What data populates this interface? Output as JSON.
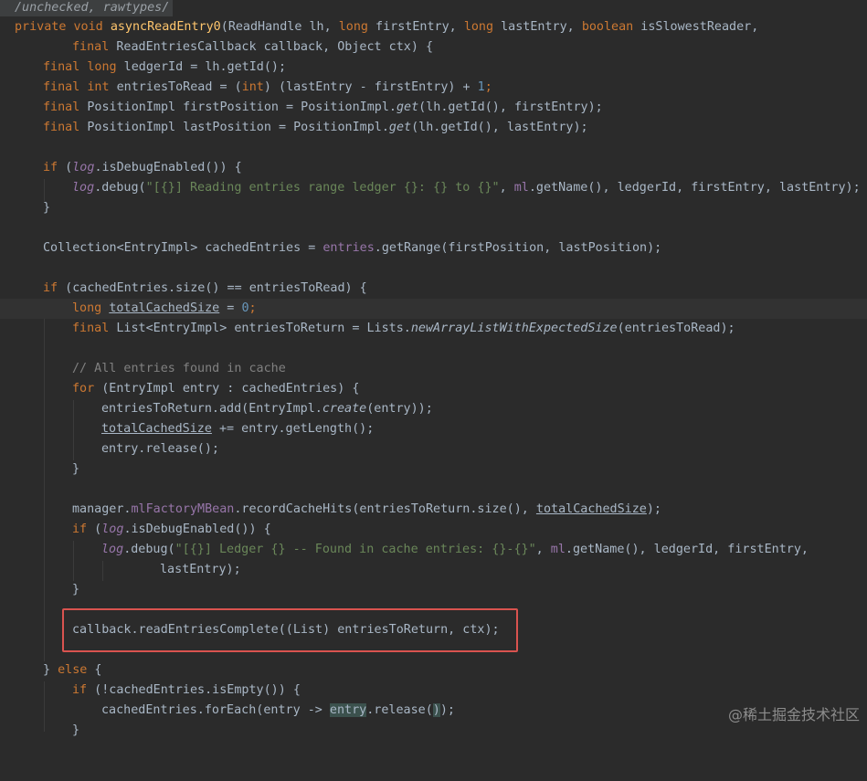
{
  "banner": "/unchecked, rawtypes/",
  "method_signature": {
    "kw_private": "private",
    "kw_void": "void",
    "name": "asyncReadEntry0",
    "open": "(",
    "p1_type": "ReadHandle lh, ",
    "kw_long1": "long",
    "p2": " firstEntry, ",
    "kw_long2": "long",
    "p3": " lastEntry, ",
    "kw_boolean": "boolean",
    "p4": " isSlowestReader,",
    "cont_kw_final": "final",
    "cont_rest": " ReadEntriesCallback callback, Object ctx) {"
  },
  "lines": {
    "l_ledger": [
      "final",
      " ",
      "long",
      " ledgerId = lh.getId();"
    ],
    "l_toread_a": "final",
    "l_toread_b": "int",
    "l_toread_c": " entriesToRead = (",
    "l_toread_d": "int",
    "l_toread_e": ") (lastEntry - firstEntry) + ",
    "l_toread_num": "1",
    "l_toread_f": ";",
    "l_firstpos_a": "final",
    "l_firstpos_b": " PositionImpl firstPosition = PositionImpl.",
    "l_firstpos_c": "get",
    "l_firstpos_d": "(lh.getId(), firstEntry);",
    "l_lastpos_a": "final",
    "l_lastpos_b": " PositionImpl lastPosition = PositionImpl.",
    "l_lastpos_c": "get",
    "l_lastpos_d": "(lh.getId(), lastEntry);",
    "if1_a": "if",
    "if1_b": " (",
    "if1_c": "log",
    "if1_d": ".isDebugEnabled()) {",
    "dbg1_a": "log",
    "dbg1_b": ".debug(",
    "dbg1_c": "\"[{}] Reading entries range ledger {}: {} to {}\"",
    "dbg1_d": ", ",
    "dbg1_e": "ml",
    "dbg1_f": ".getName(), ledgerId, firstEntry, lastEntry);",
    "close1": "}",
    "coll_a": "Collection<EntryImpl> cachedEntries = ",
    "coll_b": "entries",
    "coll_c": ".getRange(firstPosition, lastPosition);",
    "if2_a": "if",
    "if2_b": " (cachedEntries.size() == entriesToRead) {",
    "tot_a": "long",
    "tot_b": "totalCachedSize",
    "tot_c": " = ",
    "tot_d": "0",
    "tot_e": ";",
    "list_a": "final",
    "list_b": " List<EntryImpl> entriesToReturn = Lists.",
    "list_c": "newArrayListWithExpectedSize",
    "list_d": "(entriesToRead);",
    "comment": "// All entries found in cache",
    "for_a": "for",
    "for_b": " (EntryImpl entry : cachedEntries) {",
    "add_a": "entriesToReturn.add(EntryImpl.",
    "add_b": "create",
    "add_c": "(entry));",
    "sum_a": "totalCachedSize",
    "sum_b": " += entry.getLength();",
    "rel": "entry.release();",
    "close2": "}",
    "mgr_a": "manager.",
    "mgr_b": "mlFactoryMBean",
    "mgr_c": ".recordCacheHits(entriesToReturn.size(), ",
    "mgr_d": "totalCachedSize",
    "mgr_e": ");",
    "if3_a": "if",
    "if3_b": " (",
    "if3_c": "log",
    "if3_d": ".isDebugEnabled()) {",
    "dbg2_a": "log",
    "dbg2_b": ".debug(",
    "dbg2_c": "\"[{}] Ledger {} -- Found in cache entries: {}-{}\"",
    "dbg2_d": ", ",
    "dbg2_e": "ml",
    "dbg2_f": ".getName(), ledgerId, firstEntry,",
    "dbg2_g": "lastEntry);",
    "close3": "}",
    "cb": "callback.readEntriesComplete((List) entriesToReturn, ctx);",
    "else_a": "} ",
    "else_b": "else",
    "else_c": " {",
    "if4_a": "if",
    "if4_b": " (!cachedEntries.isEmpty()) {",
    "each_a": "cachedEntries.forEach(entry -> ",
    "each_b": "entry",
    "each_c": ".release(",
    "each_d": ")",
    "each_e": ");",
    "close4": "}"
  },
  "watermark": "@稀土掘金技术社区"
}
